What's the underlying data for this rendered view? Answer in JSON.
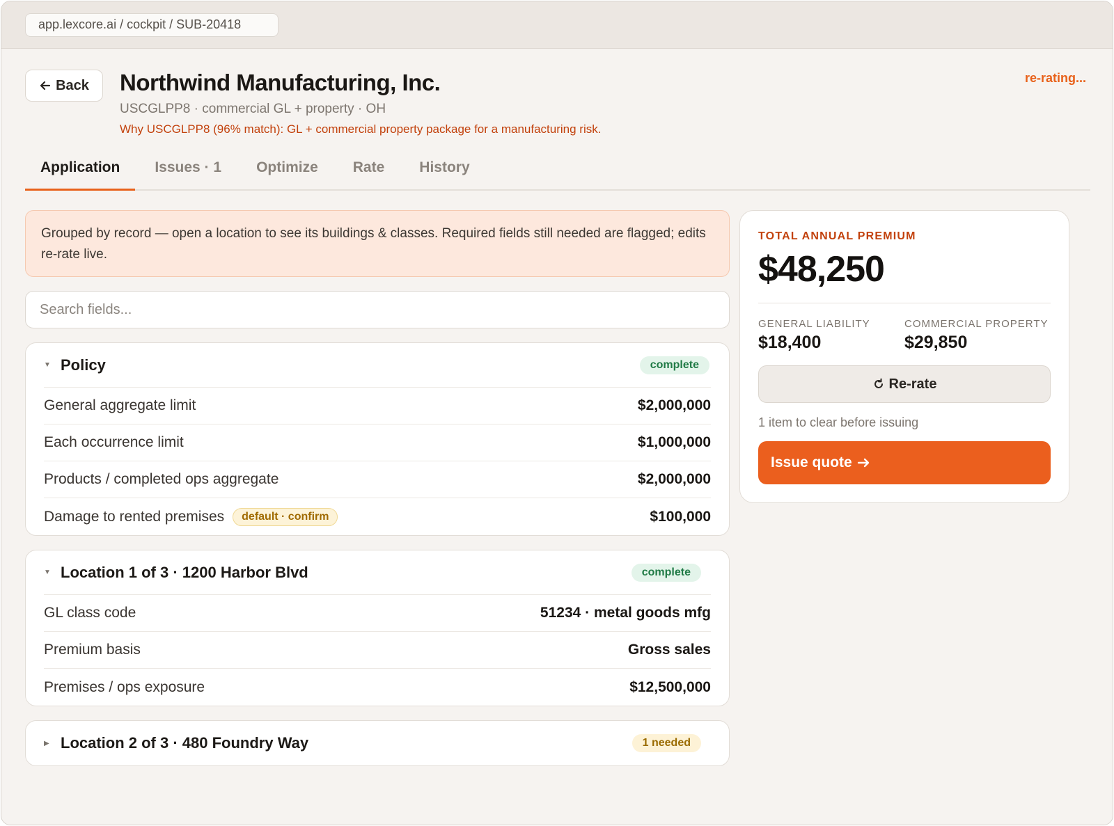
{
  "browser": {
    "url": "app.lexcore.ai / cockpit / SUB-20418"
  },
  "header": {
    "back_label": "Back",
    "title": "Northwind Manufacturing, Inc.",
    "subtitle": "USCGLPP8 · commercial GL + property · OH",
    "why": "Why USCGLPP8 (96% match): GL + commercial property package for a manufacturing risk.",
    "status": "re-rating..."
  },
  "tabs": [
    {
      "label": "Application",
      "active": true
    },
    {
      "label": "Issues · 1",
      "active": false
    },
    {
      "label": "Optimize",
      "active": false
    },
    {
      "label": "Rate",
      "active": false
    },
    {
      "label": "History",
      "active": false
    }
  ],
  "notice": "Grouped by record — open a location to see its buildings & classes. Required fields still needed are flagged; edits re-rate live.",
  "search": {
    "placeholder": "Search fields..."
  },
  "sections": {
    "policy": {
      "title": "Policy",
      "badge": "complete",
      "rows": [
        {
          "label": "General aggregate limit",
          "value": "$2,000,000"
        },
        {
          "label": "Each occurrence limit",
          "value": "$1,000,000"
        },
        {
          "label": "Products / completed ops aggregate",
          "value": "$2,000,000"
        },
        {
          "label": "Damage to rented premises",
          "pill": "default · confirm",
          "value": "$100,000"
        }
      ]
    },
    "location1": {
      "title": "Location 1 of 3 · 1200 Harbor Blvd",
      "badge": "complete",
      "rows": [
        {
          "label": "GL class code",
          "value": "51234 · metal goods mfg"
        },
        {
          "label": "Premium basis",
          "value": "Gross sales"
        },
        {
          "label": "Premises / ops exposure",
          "value": "$12,500,000"
        }
      ]
    },
    "location2": {
      "title": "Location 2 of 3 · 480 Foundry Way",
      "badge": "1 needed"
    }
  },
  "summary": {
    "label": "TOTAL ANNUAL PREMIUM",
    "total": "$48,250",
    "gl_label": "GENERAL LIABILITY",
    "gl_value": "$18,400",
    "prop_label": "COMMERCIAL PROPERTY",
    "prop_value": "$29,850",
    "rerate_label": "Re-rate",
    "clear_note": "1 item to clear before issuing",
    "issue_label": "Issue quote"
  },
  "icons": {
    "back": "arrow-left-icon",
    "rerate": "refresh-icon",
    "issue": "arrow-right-icon",
    "expanded": "caret-down-icon",
    "collapsed": "caret-right-icon"
  },
  "colors": {
    "accent": "#eb5f1e",
    "accent_text": "#c2410c",
    "complete_bg": "#e3f4ea",
    "complete_text": "#1f7a45",
    "needed_bg": "#fdf2d6",
    "needed_text": "#9a6b00",
    "notice_bg": "#fde8dd"
  }
}
